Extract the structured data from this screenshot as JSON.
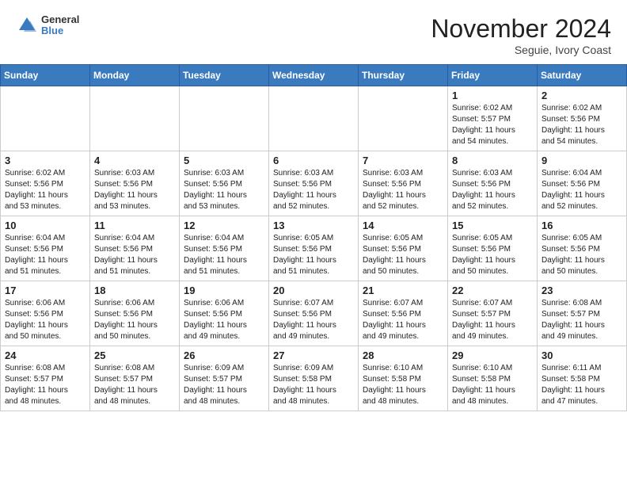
{
  "header": {
    "logo_general": "General",
    "logo_blue": "Blue",
    "month_title": "November 2024",
    "location": "Seguie, Ivory Coast"
  },
  "weekdays": [
    "Sunday",
    "Monday",
    "Tuesday",
    "Wednesday",
    "Thursday",
    "Friday",
    "Saturday"
  ],
  "weeks": [
    [
      {
        "day": "",
        "info": ""
      },
      {
        "day": "",
        "info": ""
      },
      {
        "day": "",
        "info": ""
      },
      {
        "day": "",
        "info": ""
      },
      {
        "day": "",
        "info": ""
      },
      {
        "day": "1",
        "info": "Sunrise: 6:02 AM\nSunset: 5:57 PM\nDaylight: 11 hours\nand 54 minutes."
      },
      {
        "day": "2",
        "info": "Sunrise: 6:02 AM\nSunset: 5:56 PM\nDaylight: 11 hours\nand 54 minutes."
      }
    ],
    [
      {
        "day": "3",
        "info": "Sunrise: 6:02 AM\nSunset: 5:56 PM\nDaylight: 11 hours\nand 53 minutes."
      },
      {
        "day": "4",
        "info": "Sunrise: 6:03 AM\nSunset: 5:56 PM\nDaylight: 11 hours\nand 53 minutes."
      },
      {
        "day": "5",
        "info": "Sunrise: 6:03 AM\nSunset: 5:56 PM\nDaylight: 11 hours\nand 53 minutes."
      },
      {
        "day": "6",
        "info": "Sunrise: 6:03 AM\nSunset: 5:56 PM\nDaylight: 11 hours\nand 52 minutes."
      },
      {
        "day": "7",
        "info": "Sunrise: 6:03 AM\nSunset: 5:56 PM\nDaylight: 11 hours\nand 52 minutes."
      },
      {
        "day": "8",
        "info": "Sunrise: 6:03 AM\nSunset: 5:56 PM\nDaylight: 11 hours\nand 52 minutes."
      },
      {
        "day": "9",
        "info": "Sunrise: 6:04 AM\nSunset: 5:56 PM\nDaylight: 11 hours\nand 52 minutes."
      }
    ],
    [
      {
        "day": "10",
        "info": "Sunrise: 6:04 AM\nSunset: 5:56 PM\nDaylight: 11 hours\nand 51 minutes."
      },
      {
        "day": "11",
        "info": "Sunrise: 6:04 AM\nSunset: 5:56 PM\nDaylight: 11 hours\nand 51 minutes."
      },
      {
        "day": "12",
        "info": "Sunrise: 6:04 AM\nSunset: 5:56 PM\nDaylight: 11 hours\nand 51 minutes."
      },
      {
        "day": "13",
        "info": "Sunrise: 6:05 AM\nSunset: 5:56 PM\nDaylight: 11 hours\nand 51 minutes."
      },
      {
        "day": "14",
        "info": "Sunrise: 6:05 AM\nSunset: 5:56 PM\nDaylight: 11 hours\nand 50 minutes."
      },
      {
        "day": "15",
        "info": "Sunrise: 6:05 AM\nSunset: 5:56 PM\nDaylight: 11 hours\nand 50 minutes."
      },
      {
        "day": "16",
        "info": "Sunrise: 6:05 AM\nSunset: 5:56 PM\nDaylight: 11 hours\nand 50 minutes."
      }
    ],
    [
      {
        "day": "17",
        "info": "Sunrise: 6:06 AM\nSunset: 5:56 PM\nDaylight: 11 hours\nand 50 minutes."
      },
      {
        "day": "18",
        "info": "Sunrise: 6:06 AM\nSunset: 5:56 PM\nDaylight: 11 hours\nand 50 minutes."
      },
      {
        "day": "19",
        "info": "Sunrise: 6:06 AM\nSunset: 5:56 PM\nDaylight: 11 hours\nand 49 minutes."
      },
      {
        "day": "20",
        "info": "Sunrise: 6:07 AM\nSunset: 5:56 PM\nDaylight: 11 hours\nand 49 minutes."
      },
      {
        "day": "21",
        "info": "Sunrise: 6:07 AM\nSunset: 5:56 PM\nDaylight: 11 hours\nand 49 minutes."
      },
      {
        "day": "22",
        "info": "Sunrise: 6:07 AM\nSunset: 5:57 PM\nDaylight: 11 hours\nand 49 minutes."
      },
      {
        "day": "23",
        "info": "Sunrise: 6:08 AM\nSunset: 5:57 PM\nDaylight: 11 hours\nand 49 minutes."
      }
    ],
    [
      {
        "day": "24",
        "info": "Sunrise: 6:08 AM\nSunset: 5:57 PM\nDaylight: 11 hours\nand 48 minutes."
      },
      {
        "day": "25",
        "info": "Sunrise: 6:08 AM\nSunset: 5:57 PM\nDaylight: 11 hours\nand 48 minutes."
      },
      {
        "day": "26",
        "info": "Sunrise: 6:09 AM\nSunset: 5:57 PM\nDaylight: 11 hours\nand 48 minutes."
      },
      {
        "day": "27",
        "info": "Sunrise: 6:09 AM\nSunset: 5:58 PM\nDaylight: 11 hours\nand 48 minutes."
      },
      {
        "day": "28",
        "info": "Sunrise: 6:10 AM\nSunset: 5:58 PM\nDaylight: 11 hours\nand 48 minutes."
      },
      {
        "day": "29",
        "info": "Sunrise: 6:10 AM\nSunset: 5:58 PM\nDaylight: 11 hours\nand 48 minutes."
      },
      {
        "day": "30",
        "info": "Sunrise: 6:11 AM\nSunset: 5:58 PM\nDaylight: 11 hours\nand 47 minutes."
      }
    ]
  ]
}
